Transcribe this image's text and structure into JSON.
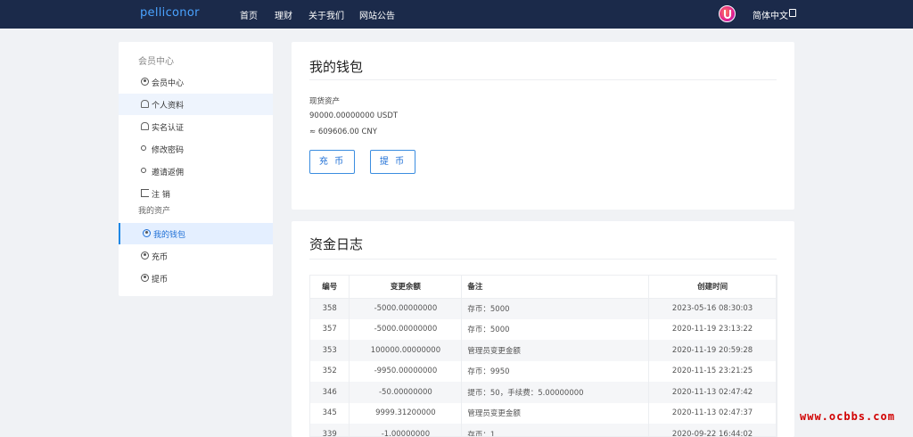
{
  "header": {
    "brand": "pelliconor",
    "nav": [
      "首页",
      "理财",
      "关于我们",
      "网站公告"
    ],
    "language": "简体中文"
  },
  "sidebar": {
    "group1_title": "会员中心",
    "group1_items": [
      "会员中心",
      "个人资料",
      "实名认证",
      "修改密码",
      "邀请返佣",
      "注 销"
    ],
    "group2_title": "我的资产",
    "group2_items": [
      "我的钱包",
      "充币",
      "提币"
    ]
  },
  "wallet": {
    "title": "我的钱包",
    "label": "现货资产",
    "amount_usdt": "90000.00000000 USDT",
    "amount_cny": "≈ 609606.00 CNY",
    "deposit_button": "充 币",
    "withdraw_button": "提 币"
  },
  "log": {
    "title": "资金日志",
    "headers": [
      "编号",
      "变更余额",
      "备注",
      "创建时间"
    ],
    "rows": [
      [
        "358",
        "-5000.00000000",
        "存币：5000",
        "2023-05-16 08:30:03"
      ],
      [
        "357",
        "-5000.00000000",
        "存币：5000",
        "2020-11-19 23:13:22"
      ],
      [
        "353",
        "100000.00000000",
        "管理员变更金额",
        "2020-11-19 20:59:28"
      ],
      [
        "352",
        "-9950.00000000",
        "存币：9950",
        "2020-11-15 23:21:25"
      ],
      [
        "346",
        "-50.00000000",
        "提币：50，手续费：5.00000000",
        "2020-11-13 02:47:42"
      ],
      [
        "345",
        "9999.31200000",
        "管理员变更金额",
        "2020-11-13 02:47:37"
      ],
      [
        "339",
        "-1.00000000",
        "存币：1",
        "2020-09-22 16:44:02"
      ]
    ]
  },
  "watermark": "www.ocbbs.com"
}
